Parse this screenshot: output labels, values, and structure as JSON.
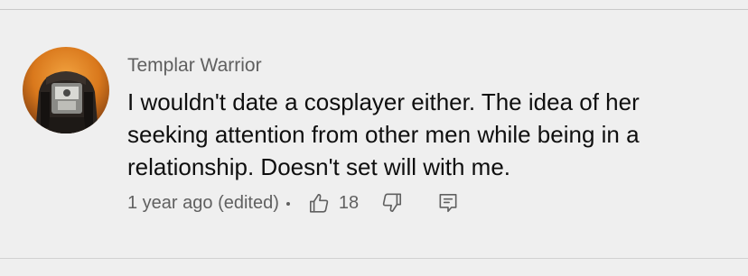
{
  "comment": {
    "author": "Templar Warrior",
    "text": "I wouldn't date a cosplayer either. The idea of her seeking attention from other men while being in a relationship. Doesn't set will with me.",
    "timestamp": "1 year ago (edited)",
    "like_count": "18",
    "icons": {
      "like": "thumbs-up-icon",
      "dislike": "thumbs-down-icon",
      "reply": "reply-comment-icon"
    }
  },
  "colors": {
    "background": "#efefef",
    "text_primary": "#0f0f0f",
    "text_secondary": "#606060",
    "divider": "#c9c9c9"
  }
}
